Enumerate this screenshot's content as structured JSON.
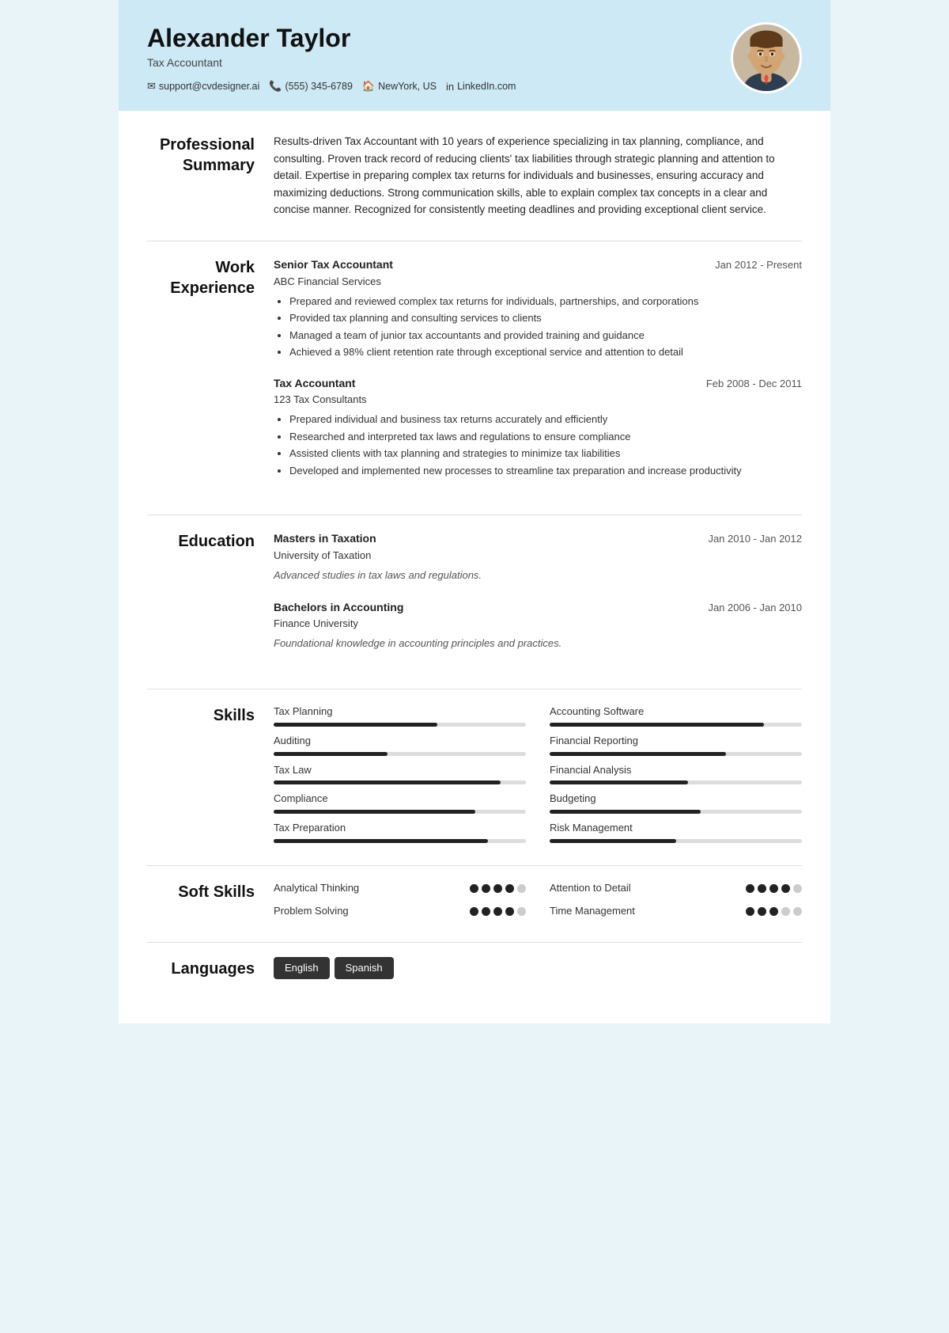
{
  "header": {
    "name": "Alexander Taylor",
    "title": "Tax Accountant",
    "contact": {
      "email": "support@cvdesigner.ai",
      "phone": "(555) 345-6789",
      "location": "NewYork, US",
      "linkedin": "LinkedIn.com"
    }
  },
  "sections": {
    "summary": {
      "label": "Professional Summary",
      "text": "Results-driven Tax Accountant with 10 years of experience specializing in tax planning, compliance, and consulting. Proven track record of reducing clients' tax liabilities through strategic planning and attention to detail. Expertise in preparing complex tax returns for individuals and businesses, ensuring accuracy and maximizing deductions. Strong communication skills, able to explain complex tax concepts in a clear and concise manner. Recognized for consistently meeting deadlines and providing exceptional client service."
    },
    "work": {
      "label": "Work Experience",
      "entries": [
        {
          "title": "Senior Tax Accountant",
          "org": "ABC Financial Services",
          "date": "Jan 2012 - Present",
          "bullets": [
            "Prepared and reviewed complex tax returns for individuals, partnerships, and corporations",
            "Provided tax planning and consulting services to clients",
            "Managed a team of junior tax accountants and provided training and guidance",
            "Achieved a 98% client retention rate through exceptional service and attention to detail"
          ]
        },
        {
          "title": "Tax Accountant",
          "org": "123 Tax Consultants",
          "date": "Feb 2008 - Dec 2011",
          "bullets": [
            "Prepared individual and business tax returns accurately and efficiently",
            "Researched and interpreted tax laws and regulations to ensure compliance",
            "Assisted clients with tax planning and strategies to minimize tax liabilities",
            "Developed and implemented new processes to streamline tax preparation and increase productivity"
          ]
        }
      ]
    },
    "education": {
      "label": "Education",
      "entries": [
        {
          "title": "Masters in Taxation",
          "org": "University of Taxation",
          "date": "Jan 2010 - Jan 2012",
          "desc": "Advanced studies in tax laws and regulations."
        },
        {
          "title": "Bachelors in Accounting",
          "org": "Finance University",
          "date": "Jan 2006 - Jan 2010",
          "desc": "Foundational knowledge in accounting principles and practices."
        }
      ]
    },
    "skills": {
      "label": "Skills",
      "items": [
        {
          "name": "Tax Planning",
          "pct": 65
        },
        {
          "name": "Accounting Software",
          "pct": 85
        },
        {
          "name": "Auditing",
          "pct": 45
        },
        {
          "name": "Financial Reporting",
          "pct": 70
        },
        {
          "name": "Tax Law",
          "pct": 90
        },
        {
          "name": "Financial Analysis",
          "pct": 55
        },
        {
          "name": "Compliance",
          "pct": 80
        },
        {
          "name": "Budgeting",
          "pct": 60
        },
        {
          "name": "Tax Preparation",
          "pct": 85
        },
        {
          "name": "Risk Management",
          "pct": 50
        }
      ]
    },
    "soft_skills": {
      "label": "Soft Skills",
      "items": [
        {
          "name": "Analytical Thinking",
          "filled": 4,
          "total": 5
        },
        {
          "name": "Attention to Detail",
          "filled": 4,
          "total": 5
        },
        {
          "name": "Problem Solving",
          "filled": 4,
          "total": 5
        },
        {
          "name": "Time Management",
          "filled": 3,
          "total": 5
        }
      ]
    },
    "languages": {
      "label": "Languages",
      "items": [
        "English",
        "Spanish"
      ]
    }
  }
}
